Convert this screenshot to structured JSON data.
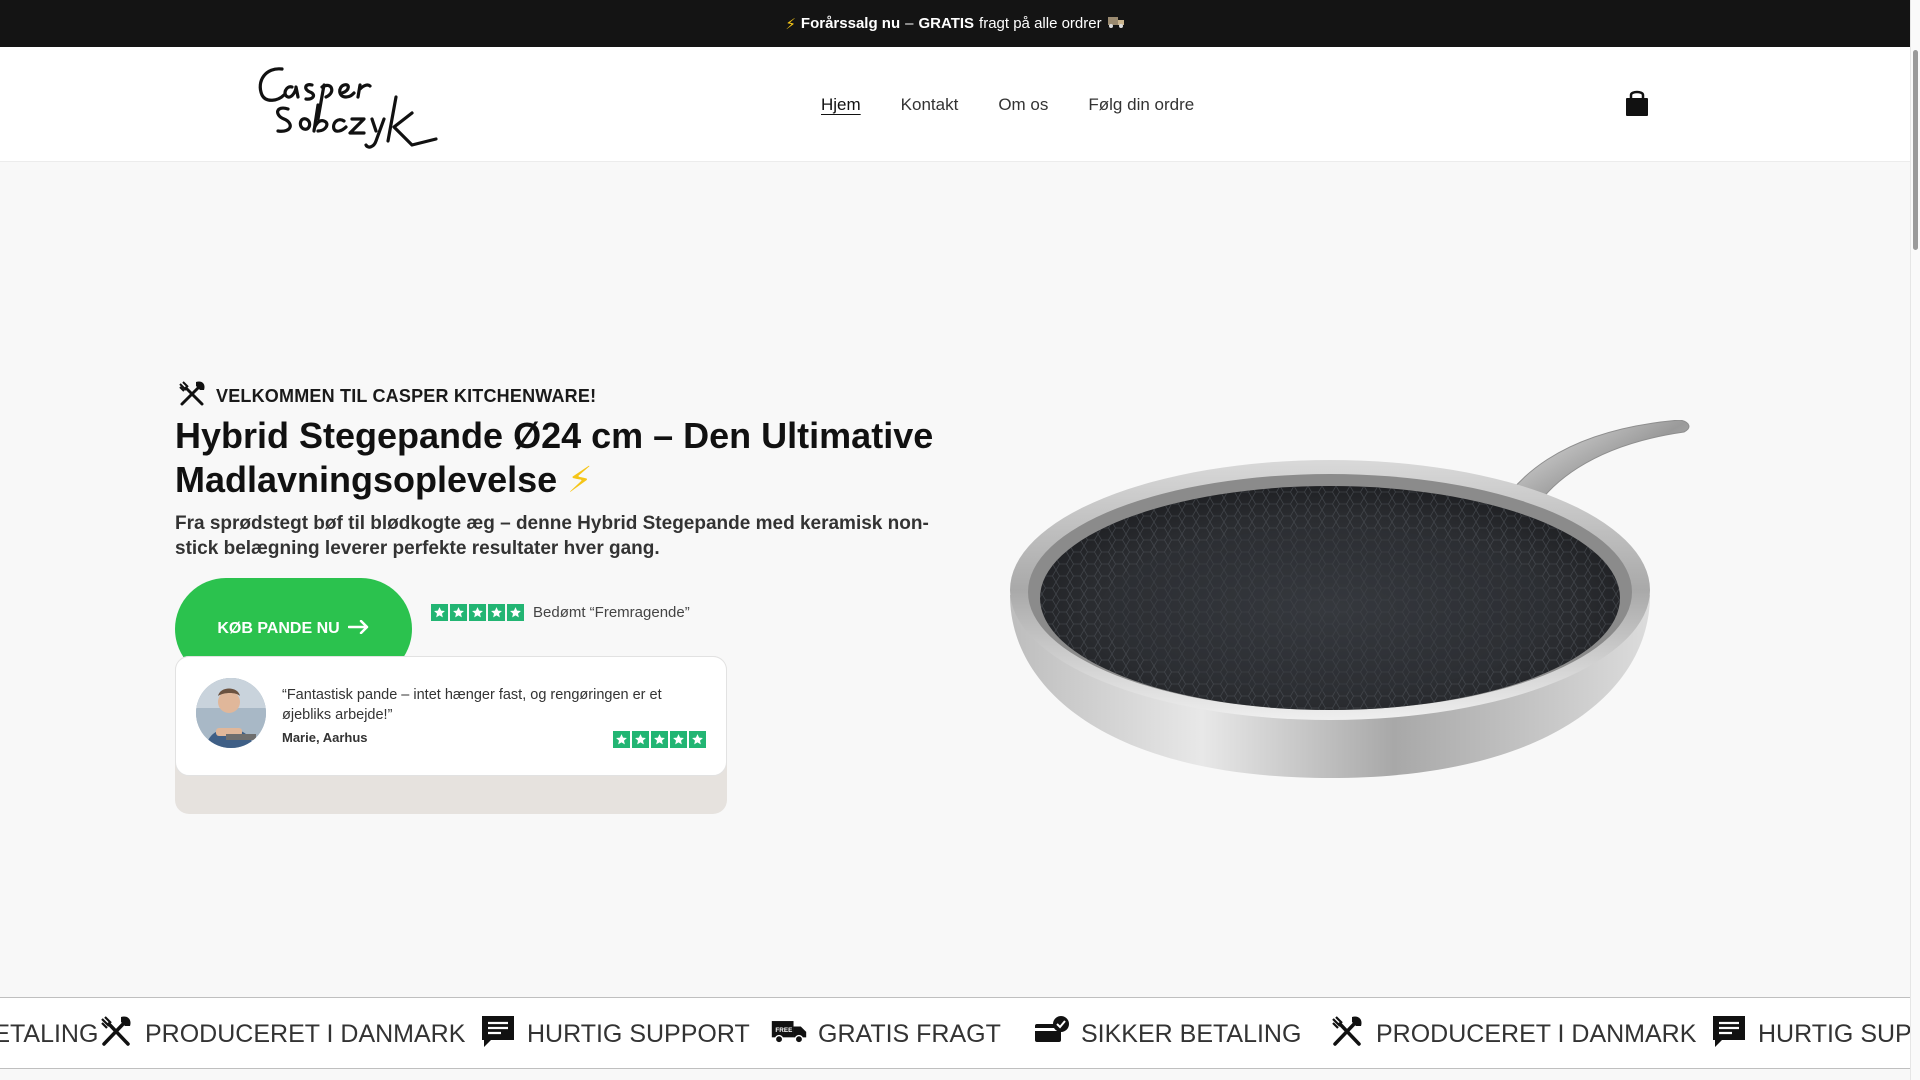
{
  "announcement": {
    "icon": "lightning-icon",
    "bold_part": "Forårssalg nu",
    "dash": "–",
    "gratis": "GRATIS",
    "rest": "fragt på alle ordrer",
    "trailing_icon": "truck-emoji-icon"
  },
  "header": {
    "logo_text": "Casper Sobczyk",
    "nav": [
      "Hjem",
      "Kontakt",
      "Om os",
      "Følg din ordre"
    ],
    "active_nav": "Hjem",
    "cart_icon": "shopping-bag-icon"
  },
  "hero": {
    "welcome_icon": "utensils-icon",
    "welcome": "VELKOMMEN TIL CASPER KITCHENWARE!",
    "headline": "Hybrid Stegepande Ø24 cm – Den Ultimative Madlavningsoplevelse",
    "headline_emoji": "⚡",
    "subline": "Fra sprødstegt bøf til blødkogte æg – denne Hybrid Stegepande med keramisk non-stick belægning leverer perfekte resultater hver gang.",
    "cta_label": "KØB PANDE NU",
    "cta_icon": "arrow-right-icon",
    "rating_stars": 5,
    "rating_text": "Bedømt “Fremragende”"
  },
  "review": {
    "quote": "“Fantastisk pande – intet hænger fast, og rengøringen er et øjebliks arbejde!”",
    "author": "Marie, Aarhus",
    "stars": 5
  },
  "marquee": [
    {
      "icon": "card-check-icon",
      "label": "SIKKER BETALING"
    },
    {
      "icon": "utensils-icon",
      "label": "PRODUCERET I DANMARK"
    },
    {
      "icon": "chat-icon",
      "label": "HURTIG SUPPORT"
    },
    {
      "icon": "free-truck-icon",
      "label": "GRATIS FRAGT"
    },
    {
      "icon": "card-check-icon",
      "label": "SIKKER BETALING"
    },
    {
      "icon": "utensils-icon",
      "label": "PRODUCERET I DANMARK"
    },
    {
      "icon": "chat-icon",
      "label": "HURTIG SUPPORT"
    }
  ],
  "colors": {
    "announcement_bg": "#141414",
    "cta_green": "#2bc24e",
    "trustpilot_green": "#22b573"
  }
}
